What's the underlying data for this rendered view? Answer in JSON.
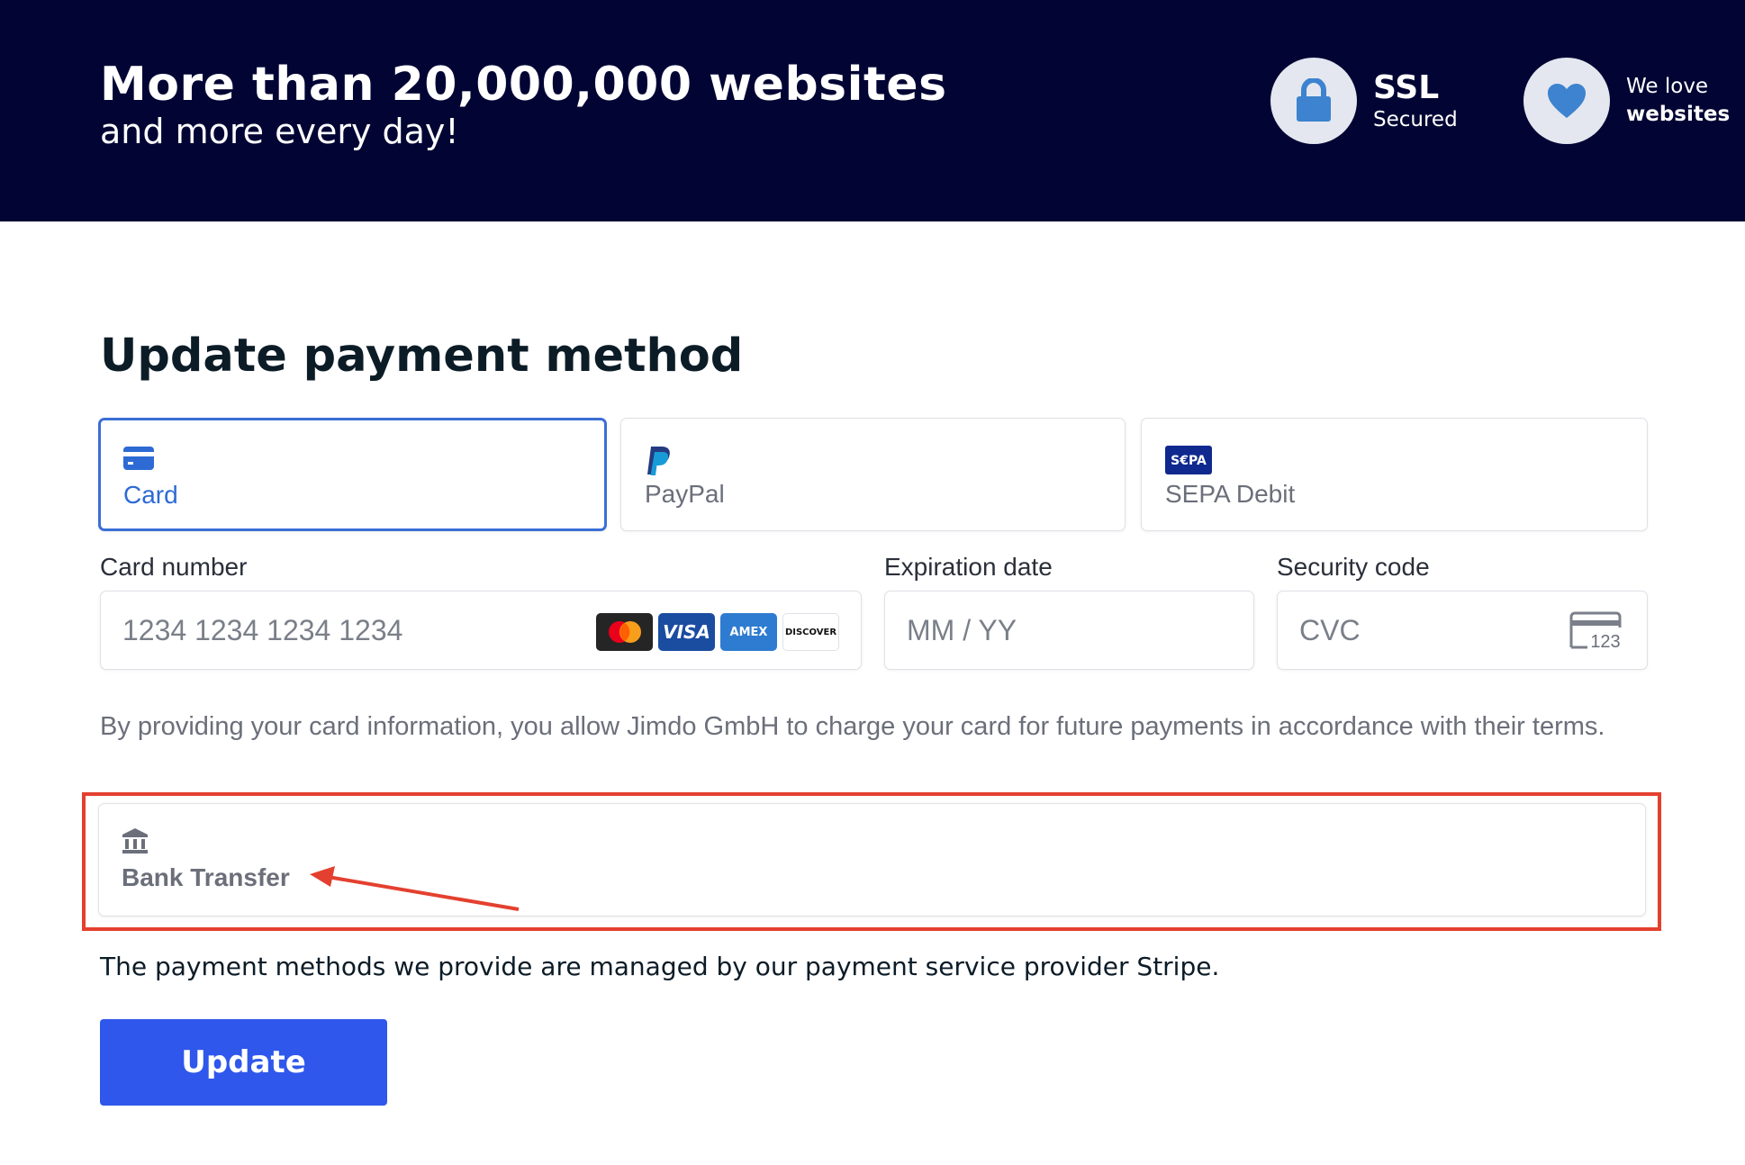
{
  "banner": {
    "title": "More than 20,000,000 websites",
    "subtitle": "and more every day!",
    "ssl": {
      "line1": "SSL",
      "line2": "Secured",
      "icon": "lock-icon"
    },
    "love": {
      "line1": "We love",
      "line2": "websites",
      "icon": "heart-icon"
    }
  },
  "main": {
    "title": "Update payment method",
    "tabs": [
      {
        "label": "Card",
        "icon": "credit-card-icon",
        "selected": true
      },
      {
        "label": "PayPal",
        "icon": "paypal-icon",
        "selected": false
      },
      {
        "label": "SEPA Debit",
        "icon": "sepa-icon",
        "selected": false
      }
    ],
    "card_number": {
      "label": "Card number",
      "placeholder": "1234 1234 1234 1234",
      "brands": [
        "mastercard",
        "VISA",
        "AMEX",
        "DISCOVER"
      ]
    },
    "expiration": {
      "label": "Expiration date",
      "placeholder": "MM / YY"
    },
    "security": {
      "label": "Security code",
      "placeholder": "CVC",
      "icon_text": "123"
    },
    "consent": "By providing your card information, you allow Jimdo GmbH to charge your card for future payments in accordance with their terms.",
    "bank_transfer": {
      "label": "Bank Transfer",
      "icon": "bank-icon"
    },
    "provider_note": "The payment methods we provide are managed by our payment service provider Stripe.",
    "update_button": "Update"
  },
  "colors": {
    "banner_bg": "#020534",
    "accent_blue": "#2f57eb",
    "selected_tab": "#3a6fd6",
    "highlight_red": "#e4402f"
  }
}
